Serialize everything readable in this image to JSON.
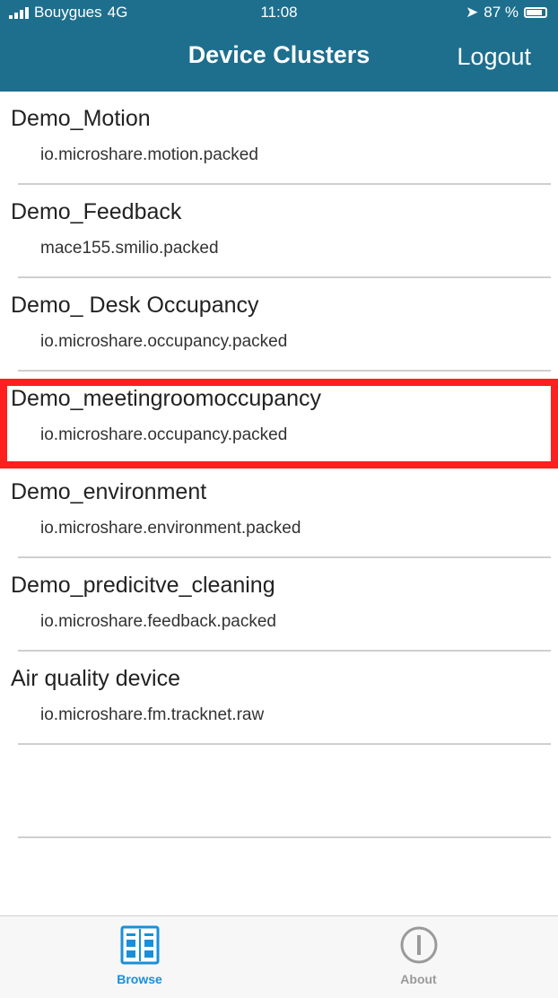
{
  "status_bar": {
    "carrier": "Bouygues",
    "network": "4G",
    "time": "11:08",
    "battery": "87 %"
  },
  "nav": {
    "title": "Device Clusters",
    "logout_label": "Logout"
  },
  "clusters": [
    {
      "name": "Demo_Motion",
      "type": "io.microshare.motion.packed"
    },
    {
      "name": "Demo_Feedback",
      "type": "mace155.smilio.packed"
    },
    {
      "name": "Demo_ Desk Occupancy",
      "type": "io.microshare.occupancy.packed"
    },
    {
      "name": "Demo_meetingroomoccupancy",
      "type": "io.microshare.occupancy.packed"
    },
    {
      "name": "Demo_environment",
      "type": "io.microshare.environment.packed"
    },
    {
      "name": "Demo_predicitve_cleaning",
      "type": "io.microshare.feedback.packed"
    },
    {
      "name": "Air quality device",
      "type": "io.microshare.fm.tracknet.raw"
    }
  ],
  "highlighted_index": 3,
  "tabs": {
    "browse_label": "Browse",
    "about_label": "About"
  },
  "colors": {
    "nav_background": "#1e6f8d",
    "highlight": "#ff1f1f",
    "active_tab": "#1a8fd8"
  }
}
